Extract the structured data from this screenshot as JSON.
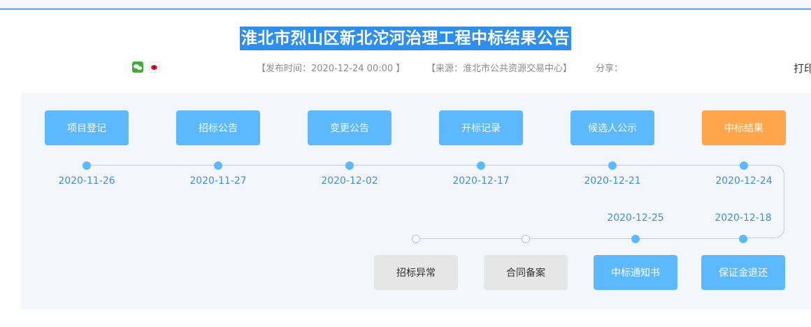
{
  "title": "淮北市烈山区新北沱河治理工程中标结果公告",
  "meta": {
    "publish_time": "【发布时间：2020-12-24 00:00 】",
    "source": "【来源：淮北市公共资源交易中心】",
    "share_label": "分享：",
    "print_label": "打印"
  },
  "share_icons": [
    "wechat-icon",
    "weibo-icon"
  ],
  "timeline": {
    "top_steps": [
      {
        "label": "项目登记",
        "date": "2020-11-26",
        "state": "normal"
      },
      {
        "label": "招标公告",
        "date": "2020-11-27",
        "state": "normal"
      },
      {
        "label": "变更公告",
        "date": "2020-12-02",
        "state": "normal"
      },
      {
        "label": "开标记录",
        "date": "2020-12-17",
        "state": "normal"
      },
      {
        "label": "候选人公示",
        "date": "2020-12-21",
        "state": "normal"
      },
      {
        "label": "中标结果",
        "date": "2020-12-24",
        "state": "active"
      }
    ],
    "bottom_steps": [
      {
        "label": "招标异常",
        "date": "",
        "state": "disabled"
      },
      {
        "label": "合同备案",
        "date": "",
        "state": "disabled"
      },
      {
        "label": "中标通知书",
        "date": "2020-12-25",
        "state": "normal"
      },
      {
        "label": "保证金退还",
        "date": "2020-12-18",
        "state": "normal"
      }
    ]
  },
  "colors": {
    "accent_blue": "#5cb8ff",
    "active_orange": "#ffa64c",
    "disabled_gray": "#e6e6e6",
    "date_text": "#3f8fd8",
    "title_highlight": "#2b8ef0"
  }
}
